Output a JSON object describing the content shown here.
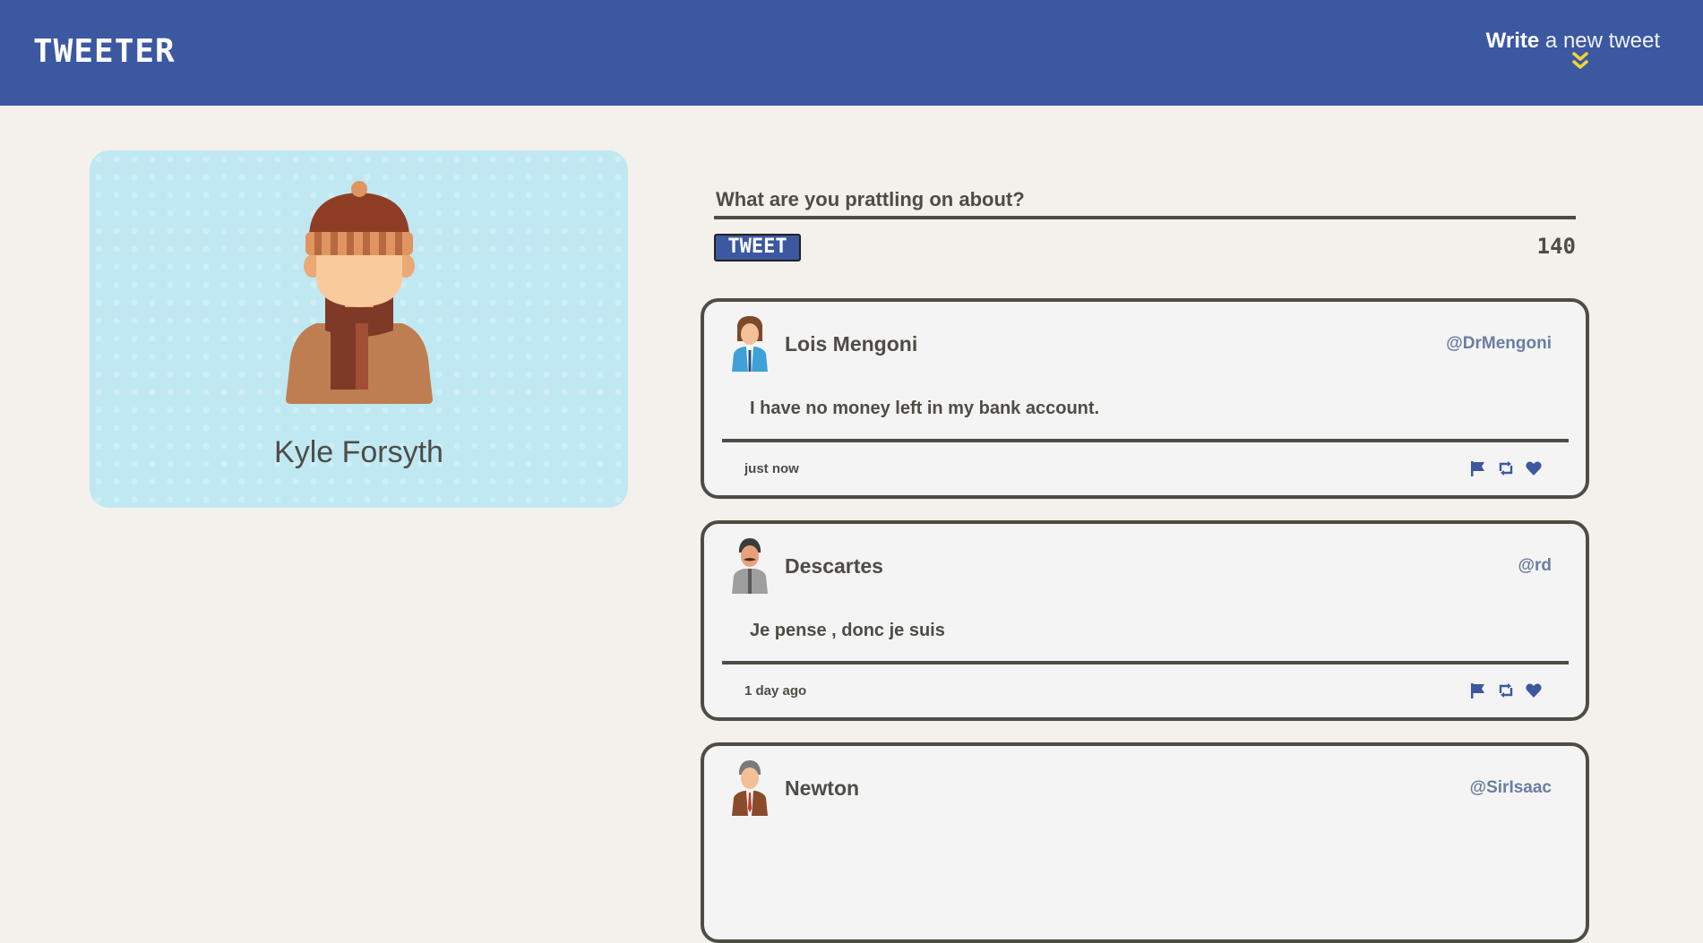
{
  "nav": {
    "brand": "TWEETER",
    "write_strong": "Write",
    "write_rest": "a new tweet",
    "chevron_icon": "double-chevron-down",
    "accent_color": "#f2d43b",
    "background": "#3b58a0"
  },
  "profile": {
    "name": "Kyle Forsyth",
    "avatar_icon": "beanie-scarf-person-avatar",
    "card_color": "#bfe8f2"
  },
  "compose": {
    "placeholder": "What are you prattling on about?",
    "button_label": "TWEET",
    "counter": "140"
  },
  "tweets": [
    {
      "name": "Lois Mengoni",
      "handle": "@DrMengoni",
      "body": "I have no money left in my bank account.",
      "time": "just now",
      "avatar_icon": "woman-business-avatar"
    },
    {
      "name": "Descartes",
      "handle": "@rd",
      "body": "Je pense , donc je suis",
      "time": "1 day ago",
      "avatar_icon": "mustache-man-avatar"
    },
    {
      "name": "Newton",
      "handle": "@SirIsaac",
      "body": "",
      "time": "",
      "avatar_icon": "man-suit-avatar"
    }
  ],
  "actions": {
    "flag_icon": "flag-icon",
    "retweet_icon": "retweet-icon",
    "like_icon": "heart-icon",
    "icon_color": "#3b58a0"
  }
}
